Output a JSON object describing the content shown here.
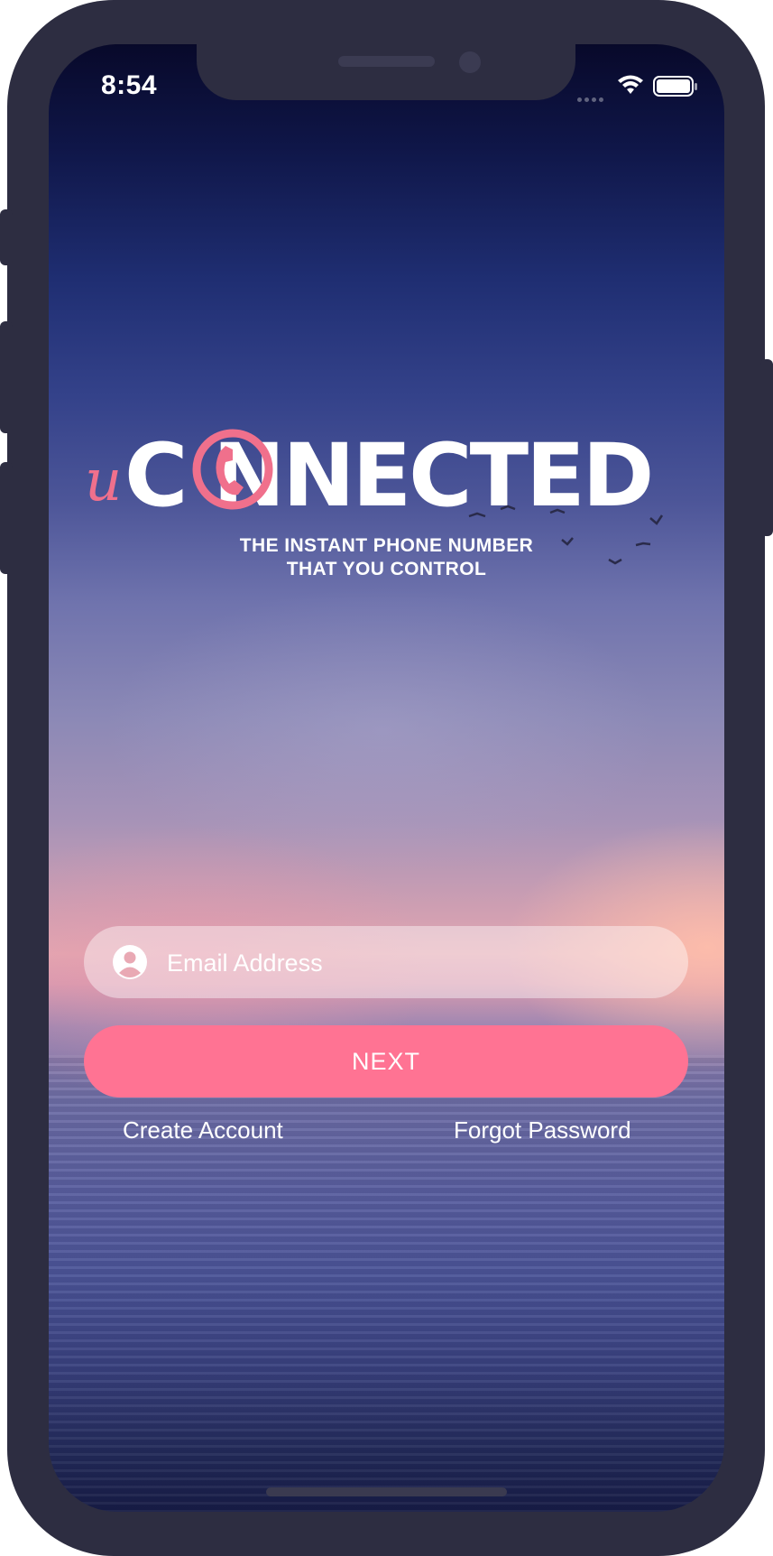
{
  "status_bar": {
    "time": "8:54",
    "icons": [
      "cellular-signal-icon",
      "wifi-icon",
      "battery-icon"
    ]
  },
  "brand": {
    "prefix": "u",
    "wordmark": "C NNECTED",
    "logo_icon": "phone-in-circle-icon",
    "tagline_line1": "THE INSTANT PHONE NUMBER",
    "tagline_line2": "THAT YOU CONTROL",
    "accent_color": "#f0708c"
  },
  "login": {
    "email_placeholder": "Email Address",
    "email_value": "",
    "email_icon": "user-circle-icon",
    "next_label": "NEXT",
    "next_color": "#ff7393",
    "create_account_label": "Create Account",
    "forgot_password_label": "Forgot Password"
  }
}
